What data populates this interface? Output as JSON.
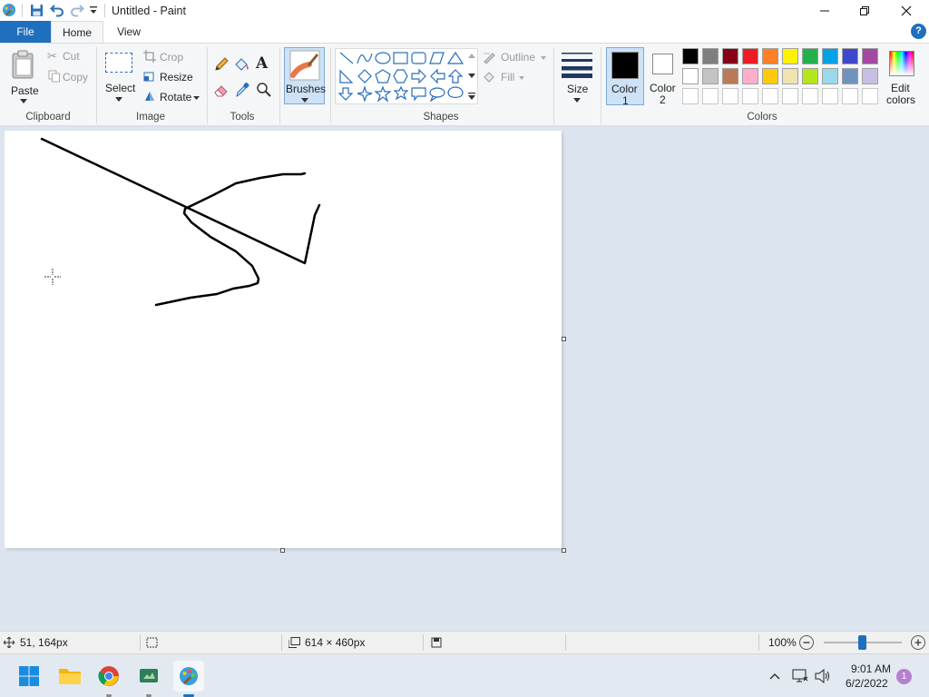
{
  "window": {
    "title": "Untitled - Paint"
  },
  "tabs": {
    "file": "File",
    "home": "Home",
    "view": "View"
  },
  "clipboard": {
    "paste": "Paste",
    "cut": "Cut",
    "copy": "Copy",
    "group": "Clipboard"
  },
  "image": {
    "select": "Select",
    "crop": "Crop",
    "resize": "Resize",
    "rotate": "Rotate",
    "group": "Image"
  },
  "tools": {
    "group": "Tools",
    "text_glyph": "A"
  },
  "brushes": {
    "label": "Brushes"
  },
  "shapes": {
    "outline": "Outline",
    "fill": "Fill",
    "group": "Shapes"
  },
  "size": {
    "label": "Size"
  },
  "colors": {
    "color1_line1": "Color",
    "color1_line2": "1",
    "color2_line1": "Color",
    "color2_line2": "2",
    "color1": "#000000",
    "color2": "#ffffff",
    "edit_line1": "Edit",
    "edit_line2": "colors",
    "group": "Colors",
    "palette_row1": [
      "#000000",
      "#7f7f7f",
      "#880015",
      "#ed1c24",
      "#ff7f27",
      "#fff200",
      "#22b14c",
      "#00a2e8",
      "#3f48cc",
      "#a349a4"
    ],
    "palette_row2": [
      "#ffffff",
      "#c3c3c3",
      "#b97a57",
      "#ffaec9",
      "#ffc90e",
      "#efe4b0",
      "#b5e61d",
      "#99d9ea",
      "#7092be",
      "#c8bfe7"
    ],
    "palette_row3": [
      "#ffffff",
      "#ffffff",
      "#ffffff",
      "#ffffff",
      "#ffffff",
      "#ffffff",
      "#ffffff",
      "#ffffff",
      "#ffffff",
      "#ffffff"
    ]
  },
  "status": {
    "cursor_pos": "51, 164px",
    "image_size": "614 × 460px",
    "zoom": "100%"
  },
  "taskbar": {
    "time": "9:01 AM",
    "date": "6/2/2022",
    "notifications": "1"
  },
  "accent": "#0063b1"
}
